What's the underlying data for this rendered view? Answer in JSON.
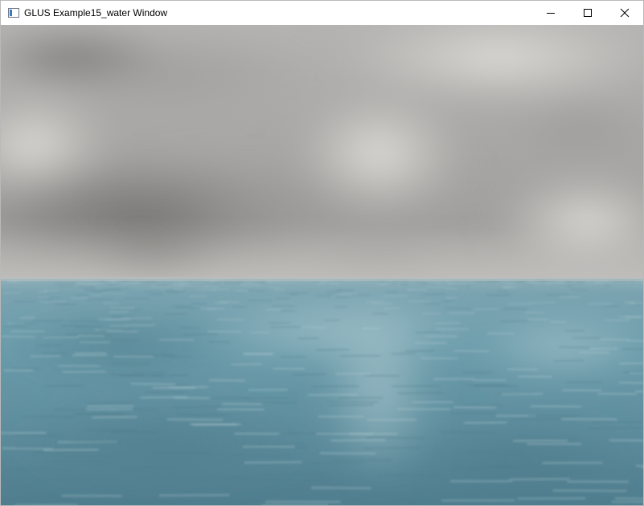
{
  "window": {
    "title": "GLUS Example15_water Window",
    "icon": "app-window-icon"
  },
  "controls": {
    "minimize_icon": "minimize-icon",
    "maximize_icon": "maximize-icon",
    "close_icon": "close-icon"
  },
  "scene": {
    "sky_color": "#a9a8a6",
    "water_color": "#6d9fae"
  }
}
